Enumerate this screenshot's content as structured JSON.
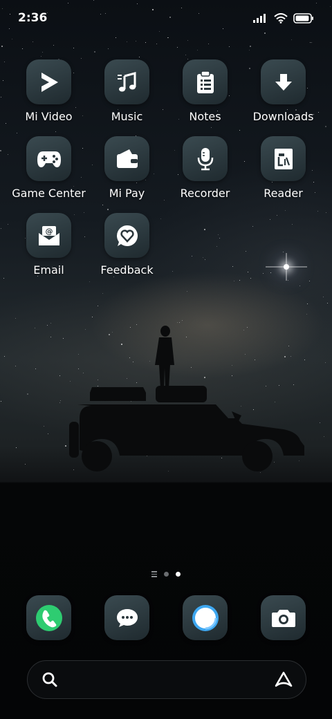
{
  "status_bar": {
    "time": "2:36",
    "icons": [
      "signal-icon",
      "wifi-icon",
      "battery-icon"
    ],
    "battery_level": 0.9
  },
  "apps": [
    {
      "label": "Mi Video",
      "icon": "play-icon"
    },
    {
      "label": "Music",
      "icon": "music-note-icon"
    },
    {
      "label": "Notes",
      "icon": "clipboard-icon"
    },
    {
      "label": "Downloads",
      "icon": "download-arrow-icon"
    },
    {
      "label": "Game Center",
      "icon": "gamepad-icon"
    },
    {
      "label": "Mi Pay",
      "icon": "wallet-icon"
    },
    {
      "label": "Recorder",
      "icon": "microphone-icon"
    },
    {
      "label": "Reader",
      "icon": "book-icon"
    },
    {
      "label": "Email",
      "icon": "envelope-icon"
    },
    {
      "label": "Feedback",
      "icon": "feedback-heart-icon"
    }
  ],
  "page_indicator": {
    "pages": 2,
    "active": 2
  },
  "dock": [
    {
      "name": "phone",
      "icon": "phone-icon",
      "accent": "#2ecc71"
    },
    {
      "name": "messages",
      "icon": "chat-bubble-icon",
      "accent": "#ffffff"
    },
    {
      "name": "browser",
      "icon": "browser-circle-icon",
      "accent": "#3ea7f0"
    },
    {
      "name": "camera",
      "icon": "camera-icon",
      "accent": "#ffffff"
    }
  ],
  "search_bar": {
    "icons": [
      "search-icon",
      "assistant-icon"
    ]
  },
  "colors": {
    "icon_bg": "#2a363b",
    "background": "#05070a"
  }
}
